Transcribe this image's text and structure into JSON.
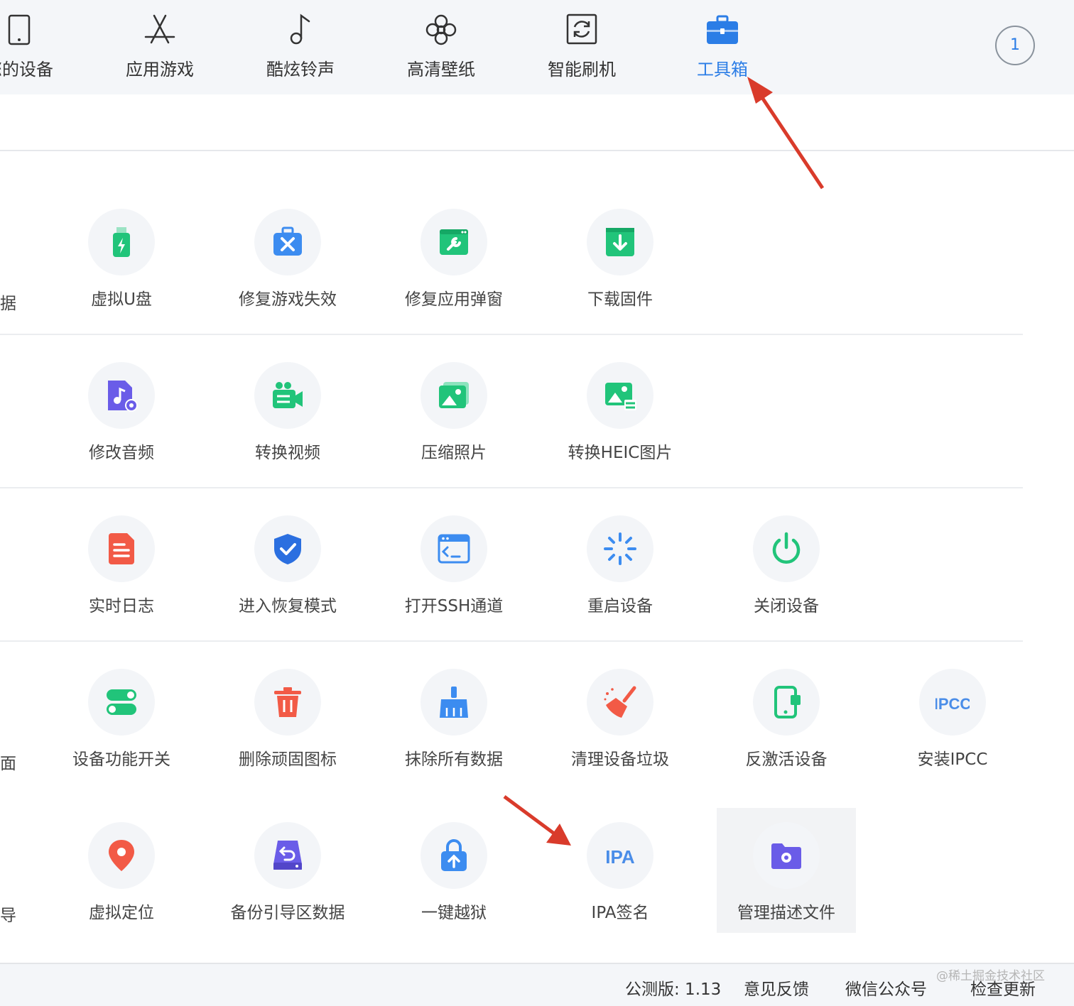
{
  "nav": {
    "items": [
      {
        "label": "您的设备",
        "icon": "tablet-icon"
      },
      {
        "label": "应用游戏",
        "icon": "app-store-icon"
      },
      {
        "label": "酷炫铃声",
        "icon": "music-note-icon"
      },
      {
        "label": "高清壁纸",
        "icon": "flower-icon"
      },
      {
        "label": "智能刷机",
        "icon": "refresh-box-icon"
      },
      {
        "label": "工具箱",
        "icon": "toolbox-icon"
      }
    ],
    "active_index": 5,
    "user_badge": "1",
    "accent_color": "#2b7de6"
  },
  "tools": {
    "row1": {
      "edge": "据",
      "items": [
        {
          "label": "虚拟U盘",
          "icon": "usb-drive-icon"
        },
        {
          "label": "修复游戏失效",
          "icon": "repair-toolbox-icon"
        },
        {
          "label": "修复应用弹窗",
          "icon": "repair-window-icon"
        },
        {
          "label": "下载固件",
          "icon": "download-icon"
        }
      ]
    },
    "row2": {
      "edge": "",
      "items": [
        {
          "label": "修改音频",
          "icon": "audio-settings-icon"
        },
        {
          "label": "转换视频",
          "icon": "video-camera-icon"
        },
        {
          "label": "压缩照片",
          "icon": "image-compress-icon"
        },
        {
          "label": "转换HEIC图片",
          "icon": "image-convert-icon"
        }
      ]
    },
    "row3": {
      "edge": "",
      "items": [
        {
          "label": "实时日志",
          "icon": "log-document-icon"
        },
        {
          "label": "进入恢复模式",
          "icon": "shield-check-icon"
        },
        {
          "label": "打开SSH通道",
          "icon": "terminal-icon"
        },
        {
          "label": "重启设备",
          "icon": "restart-spinner-icon"
        },
        {
          "label": "关闭设备",
          "icon": "power-icon"
        }
      ]
    },
    "row4": {
      "edge": "面",
      "items": [
        {
          "label": "设备功能开关",
          "icon": "toggle-switch-icon"
        },
        {
          "label": "删除顽固图标",
          "icon": "trash-icon"
        },
        {
          "label": "抹除所有数据",
          "icon": "broom-icon"
        },
        {
          "label": "清理设备垃圾",
          "icon": "sweep-icon"
        },
        {
          "label": "反激活设备",
          "icon": "deactivate-phone-icon"
        },
        {
          "label": "安装IPCC",
          "icon": "ipcc-text-icon"
        }
      ]
    },
    "row5": {
      "edge": "导",
      "items": [
        {
          "label": "虚拟定位",
          "icon": "location-pin-icon"
        },
        {
          "label": "备份引导区数据",
          "icon": "backup-drive-icon"
        },
        {
          "label": "一键越狱",
          "icon": "unlock-upload-icon"
        },
        {
          "label": "IPA签名",
          "icon": "ipa-text-icon"
        },
        {
          "label": "管理描述文件",
          "icon": "settings-folder-icon"
        }
      ],
      "selected_index": 4
    }
  },
  "status": {
    "version": "公测版: 1.13",
    "feedback": "意见反馈",
    "wechat": "微信公众号",
    "update": "检查更新",
    "watermark": "@稀土掘金技术社区"
  },
  "annotation_color": "#d93b2b"
}
